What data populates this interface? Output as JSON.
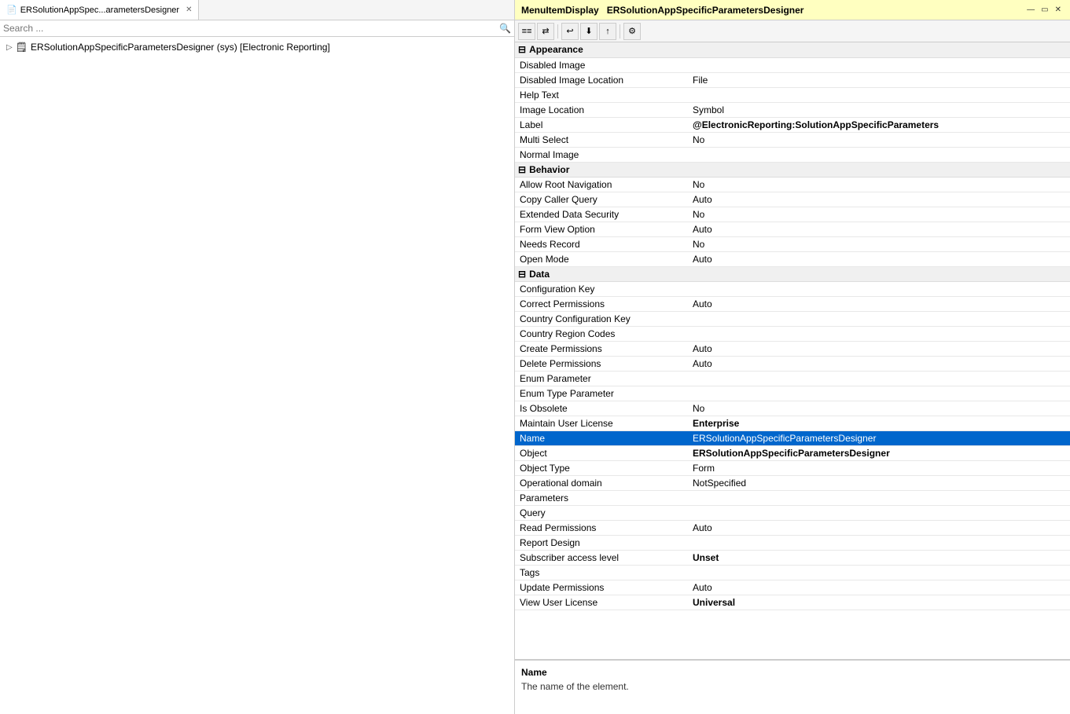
{
  "leftPanel": {
    "tabLabel": "ERSolutionAppSpec...arametersDesigner",
    "searchPlaceholder": "Search ...",
    "treeItem": "ERSolutionAppSpecificParametersDesigner (sys) [Electronic Reporting]"
  },
  "rightPanel": {
    "headerPrefix": "MenuItemDisplay",
    "headerName": "ERSolutionAppSpecificParametersDesigner",
    "windowButtons": [
      "—",
      "▭",
      "✕"
    ],
    "toolbar": {
      "buttons": [
        "≡",
        "⇄",
        "↩",
        "⬇",
        "↑",
        "⚙"
      ]
    },
    "sections": [
      {
        "name": "Appearance",
        "rows": [
          {
            "property": "Disabled Image",
            "value": ""
          },
          {
            "property": "Disabled Image Location",
            "value": "File"
          },
          {
            "property": "Help Text",
            "value": ""
          },
          {
            "property": "Image Location",
            "value": "Symbol"
          },
          {
            "property": "Label",
            "value": "@ElectronicReporting:SolutionAppSpecificParameters",
            "bold": true
          },
          {
            "property": "Multi Select",
            "value": "No"
          },
          {
            "property": "Normal Image",
            "value": ""
          }
        ]
      },
      {
        "name": "Behavior",
        "rows": [
          {
            "property": "Allow Root Navigation",
            "value": "No"
          },
          {
            "property": "Copy Caller Query",
            "value": "Auto"
          },
          {
            "property": "Extended Data Security",
            "value": "No"
          },
          {
            "property": "Form View Option",
            "value": "Auto"
          },
          {
            "property": "Needs Record",
            "value": "No"
          },
          {
            "property": "Open Mode",
            "value": "Auto"
          }
        ]
      },
      {
        "name": "Data",
        "rows": [
          {
            "property": "Configuration Key",
            "value": ""
          },
          {
            "property": "Correct Permissions",
            "value": "Auto"
          },
          {
            "property": "Country Configuration Key",
            "value": ""
          },
          {
            "property": "Country Region Codes",
            "value": ""
          },
          {
            "property": "Create Permissions",
            "value": "Auto"
          },
          {
            "property": "Delete Permissions",
            "value": "Auto"
          },
          {
            "property": "Enum Parameter",
            "value": ""
          },
          {
            "property": "Enum Type Parameter",
            "value": ""
          },
          {
            "property": "Is Obsolete",
            "value": "No"
          },
          {
            "property": "Maintain User License",
            "value": "Enterprise",
            "bold": true
          },
          {
            "property": "Name",
            "value": "ERSolutionAppSpecificParametersDesigner",
            "selected": true
          },
          {
            "property": "Object",
            "value": "ERSolutionAppSpecificParametersDesigner",
            "bold": true
          },
          {
            "property": "Object Type",
            "value": "Form"
          },
          {
            "property": "Operational domain",
            "value": "NotSpecified"
          },
          {
            "property": "Parameters",
            "value": ""
          },
          {
            "property": "Query",
            "value": ""
          },
          {
            "property": "Read Permissions",
            "value": "Auto"
          },
          {
            "property": "Report Design",
            "value": ""
          },
          {
            "property": "Subscriber access level",
            "value": "Unset",
            "bold": true
          },
          {
            "property": "Tags",
            "value": ""
          },
          {
            "property": "Update Permissions",
            "value": "Auto"
          },
          {
            "property": "View User License",
            "value": "Universal",
            "bold": true
          }
        ]
      }
    ],
    "footer": {
      "title": "Name",
      "description": "The name of the element."
    }
  }
}
